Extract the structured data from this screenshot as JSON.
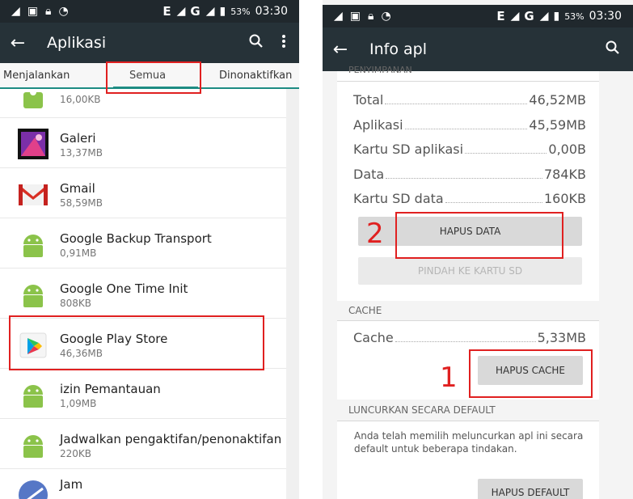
{
  "left": {
    "status": {
      "network": "E",
      "network2": "G",
      "battery": "53%",
      "time": "03:30"
    },
    "appbar": {
      "title": "Aplikasi"
    },
    "tabs": [
      "Menjalankan",
      "Semua",
      "Dinonaktifkan"
    ],
    "apps": [
      {
        "name": "",
        "size": "16,00KB",
        "icon": "android-icon"
      },
      {
        "name": "Galeri",
        "size": "13,37MB",
        "icon": "gallery-icon"
      },
      {
        "name": "Gmail",
        "size": "58,59MB",
        "icon": "gmail-icon"
      },
      {
        "name": "Google Backup Transport",
        "size": "0,91MB",
        "icon": "android-icon"
      },
      {
        "name": "Google One Time Init",
        "size": "808KB",
        "icon": "android-icon"
      },
      {
        "name": "Google Play Store",
        "size": "46,36MB",
        "icon": "play-store-icon"
      },
      {
        "name": "izin Pemantauan",
        "size": "1,09MB",
        "icon": "android-icon"
      },
      {
        "name": "Jadwalkan pengaktifan/penonaktifan",
        "size": "220KB",
        "icon": "android-icon"
      },
      {
        "name": "Jam",
        "size": "",
        "icon": "clock-icon"
      }
    ]
  },
  "right": {
    "status": {
      "network": "E",
      "network2": "G",
      "battery": "53%",
      "time": "03:30"
    },
    "appbar": {
      "title": "Info apl"
    },
    "storage_header": "PENYIMPANAN",
    "storage": [
      {
        "label": "Total",
        "value": "46,52MB"
      },
      {
        "label": "Aplikasi",
        "value": "45,59MB"
      },
      {
        "label": "Kartu SD aplikasi",
        "value": "0,00B"
      },
      {
        "label": "Data",
        "value": "784KB"
      },
      {
        "label": "Kartu SD data",
        "value": "160KB"
      }
    ],
    "clear_data_button": "HAPUS DATA",
    "move_sd_button": "PINDAH KE KARTU SD",
    "cache_header": "CACHE",
    "cache": {
      "label": "Cache",
      "value": "5,33MB"
    },
    "clear_cache_button": "HAPUS CACHE",
    "launch_header": "LUNCURKAN SECARA DEFAULT",
    "launch_text": "Anda telah memilih meluncurkan apl ini secara default untuk beberapa tindakan.",
    "clear_defaults_button": "HAPUS DEFAULT"
  },
  "annotations": {
    "step1": "1",
    "step2": "2"
  },
  "colors": {
    "accent": "#1d8c83",
    "highlight": "#e02020",
    "appbar": "#263238"
  }
}
